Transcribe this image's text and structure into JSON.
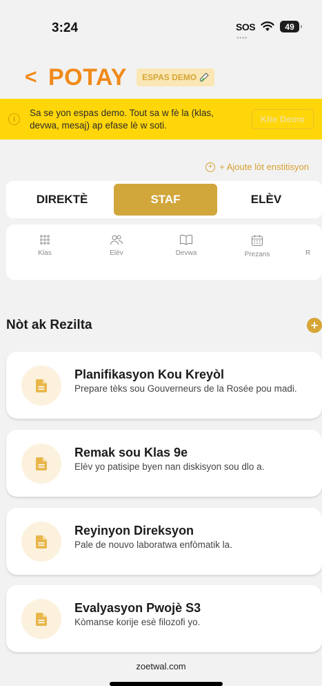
{
  "status_bar": {
    "time": "3:24",
    "sos": "SOS",
    "battery": "49"
  },
  "header": {
    "back": "<",
    "title": "POTAY",
    "demo_badge": "ESPAS DEMO",
    "demo_badge_icon": "test-tube-icon"
  },
  "banner": {
    "text": "Sa se yon espas demo. Tout sa w fè la (klas, devwa, mesaj) ap efase lè w soti.",
    "button": "Kite Demo",
    "icon": "info-icon"
  },
  "add_institution": "+ Ajoute lòt enstitisyon",
  "role_tabs": [
    {
      "label": "DIREKTÈ",
      "active": false
    },
    {
      "label": "STAF",
      "active": true
    },
    {
      "label": "ELÈV",
      "active": false
    }
  ],
  "quick_actions": [
    {
      "label": "Klas",
      "icon": "grid-icon"
    },
    {
      "label": "Elèv",
      "icon": "users-icon"
    },
    {
      "label": "Devwa",
      "icon": "book-icon"
    },
    {
      "label": "Prezans",
      "icon": "calendar-icon"
    },
    {
      "label": "R",
      "icon": "partial-icon"
    }
  ],
  "notes_section": {
    "title": "Nòt ak Rezilta",
    "items": [
      {
        "title": "Planifikasyon Kou Kreyòl",
        "body": "Prepare tèks sou Gouverneurs de la Rosée pou madi."
      },
      {
        "title": "Remak sou Klas 9e",
        "body": "Elèv yo patisipe byen nan diskisyon sou dlo a."
      },
      {
        "title": "Reyinyon Direksyon",
        "body": "Pale de nouvo laboratwa enfòmatik la."
      },
      {
        "title": "Evalyasyon Pwojè S3",
        "body": "Kòmanse korije esè filozofi yo."
      }
    ]
  },
  "browser": {
    "url": "zoetwal.com"
  },
  "colors": {
    "accent": "#f08a1a",
    "gold": "#d1a63b",
    "banner": "#ffd60a"
  }
}
